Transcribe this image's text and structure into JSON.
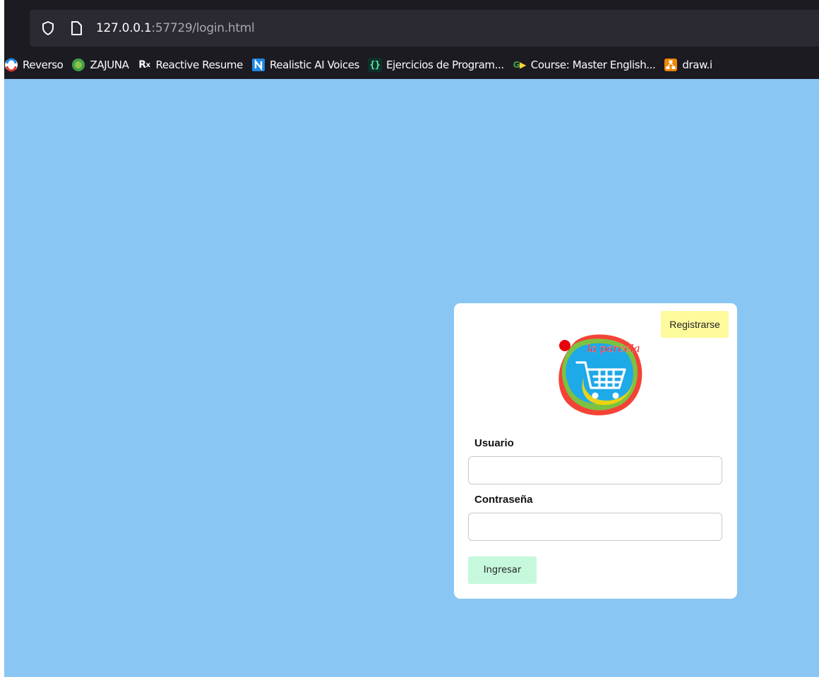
{
  "browser": {
    "url_host": "127.0.0.1",
    "url_rest": ":57729/login.html",
    "bookmarks": [
      {
        "label": "Reverso",
        "icon": "reverso-icon"
      },
      {
        "label": "ZAJUNA",
        "icon": "zajuna-icon"
      },
      {
        "label": "Reactive Resume",
        "icon": "rx-icon"
      },
      {
        "label": "Realistic AI Voices",
        "icon": "n-icon"
      },
      {
        "label": "Ejercicios de Program...",
        "icon": "braces-icon"
      },
      {
        "label": "Course: Master English...",
        "icon": "g-icon"
      },
      {
        "label": "draw.i",
        "icon": "drawio-icon"
      }
    ]
  },
  "login": {
    "register_label": "Registrarse",
    "logo_text": "la parcela",
    "username_label": "Usuario",
    "username_value": "",
    "password_label": "Contraseña",
    "password_value": "",
    "submit_label": "Ingresar"
  },
  "colors": {
    "page_background": "#89c6f4",
    "card_background": "#ffffff",
    "register_button": "#fdfb9c",
    "submit_button": "#c6f9dc",
    "browser_chrome": "#1c1b22"
  }
}
